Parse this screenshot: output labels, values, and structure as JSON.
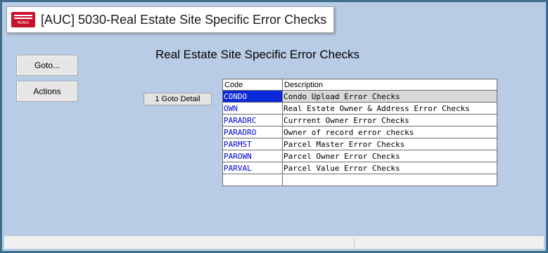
{
  "window": {
    "title": "[AUC] 5030-Real Estate Site Specific Error Checks",
    "logo_text": "MUNIS"
  },
  "sidebar": {
    "goto_label": "Goto...",
    "actions_label": "Actions"
  },
  "main": {
    "heading": "Real Estate Site Specific Error Checks",
    "detail_button_label": "1 Goto Detail"
  },
  "table": {
    "headers": {
      "code": "Code",
      "description": "Description"
    },
    "rows": [
      {
        "code": "CONDO",
        "description": "Condo Upload Error Checks",
        "selected": true
      },
      {
        "code": "OWN",
        "description": "Real Estate Owner & Address Error Checks",
        "selected": false
      },
      {
        "code": "PARADRC",
        "description": "Currrent Owner Error Checks",
        "selected": false
      },
      {
        "code": "PARADRO",
        "description": "Owner of record error checks",
        "selected": false
      },
      {
        "code": "PARMST",
        "description": "Parcel Master Error Checks",
        "selected": false
      },
      {
        "code": "PAROWN",
        "description": "Parcel Owner Error Checks",
        "selected": false
      },
      {
        "code": "PARVAL",
        "description": "Parcel Value Error Checks",
        "selected": false
      },
      {
        "code": "",
        "description": "",
        "selected": false
      }
    ]
  },
  "colors": {
    "background": "#b9cce6",
    "frame_border": "#3d6f8a",
    "selected_code": "#0a28d8",
    "selected_row": "#d9d9d9",
    "code_text": "#0000cc",
    "logo": "#c8102e"
  }
}
